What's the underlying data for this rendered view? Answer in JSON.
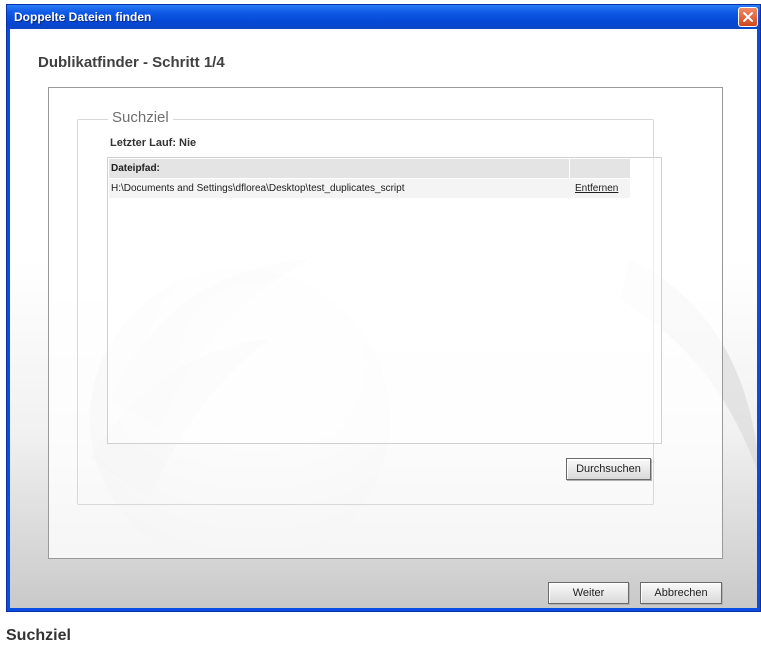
{
  "window": {
    "title": "Doppelte Dateien finden"
  },
  "wizard": {
    "heading": "Dublikatfinder - Schritt 1/4",
    "group_title": "Suchziel",
    "last_run": "Letzter Lauf: Nie"
  },
  "table": {
    "columns": [
      "Dateipfad:",
      ""
    ],
    "rows": [
      {
        "path": "H:\\Documents and Settings\\dflorea\\Desktop\\test_duplicates_script",
        "action": "Entfernen"
      }
    ]
  },
  "buttons": {
    "browse": "Durchsuchen",
    "next": "Weiter",
    "cancel": "Abbrechen"
  },
  "caption": "Suchziel",
  "colors": {
    "titlebar": "#0548d6",
    "close_button": "#d2461e",
    "heading_text": "#404040"
  },
  "icons": {
    "close": "close-icon",
    "watermark": "sphere-logo-watermark"
  }
}
